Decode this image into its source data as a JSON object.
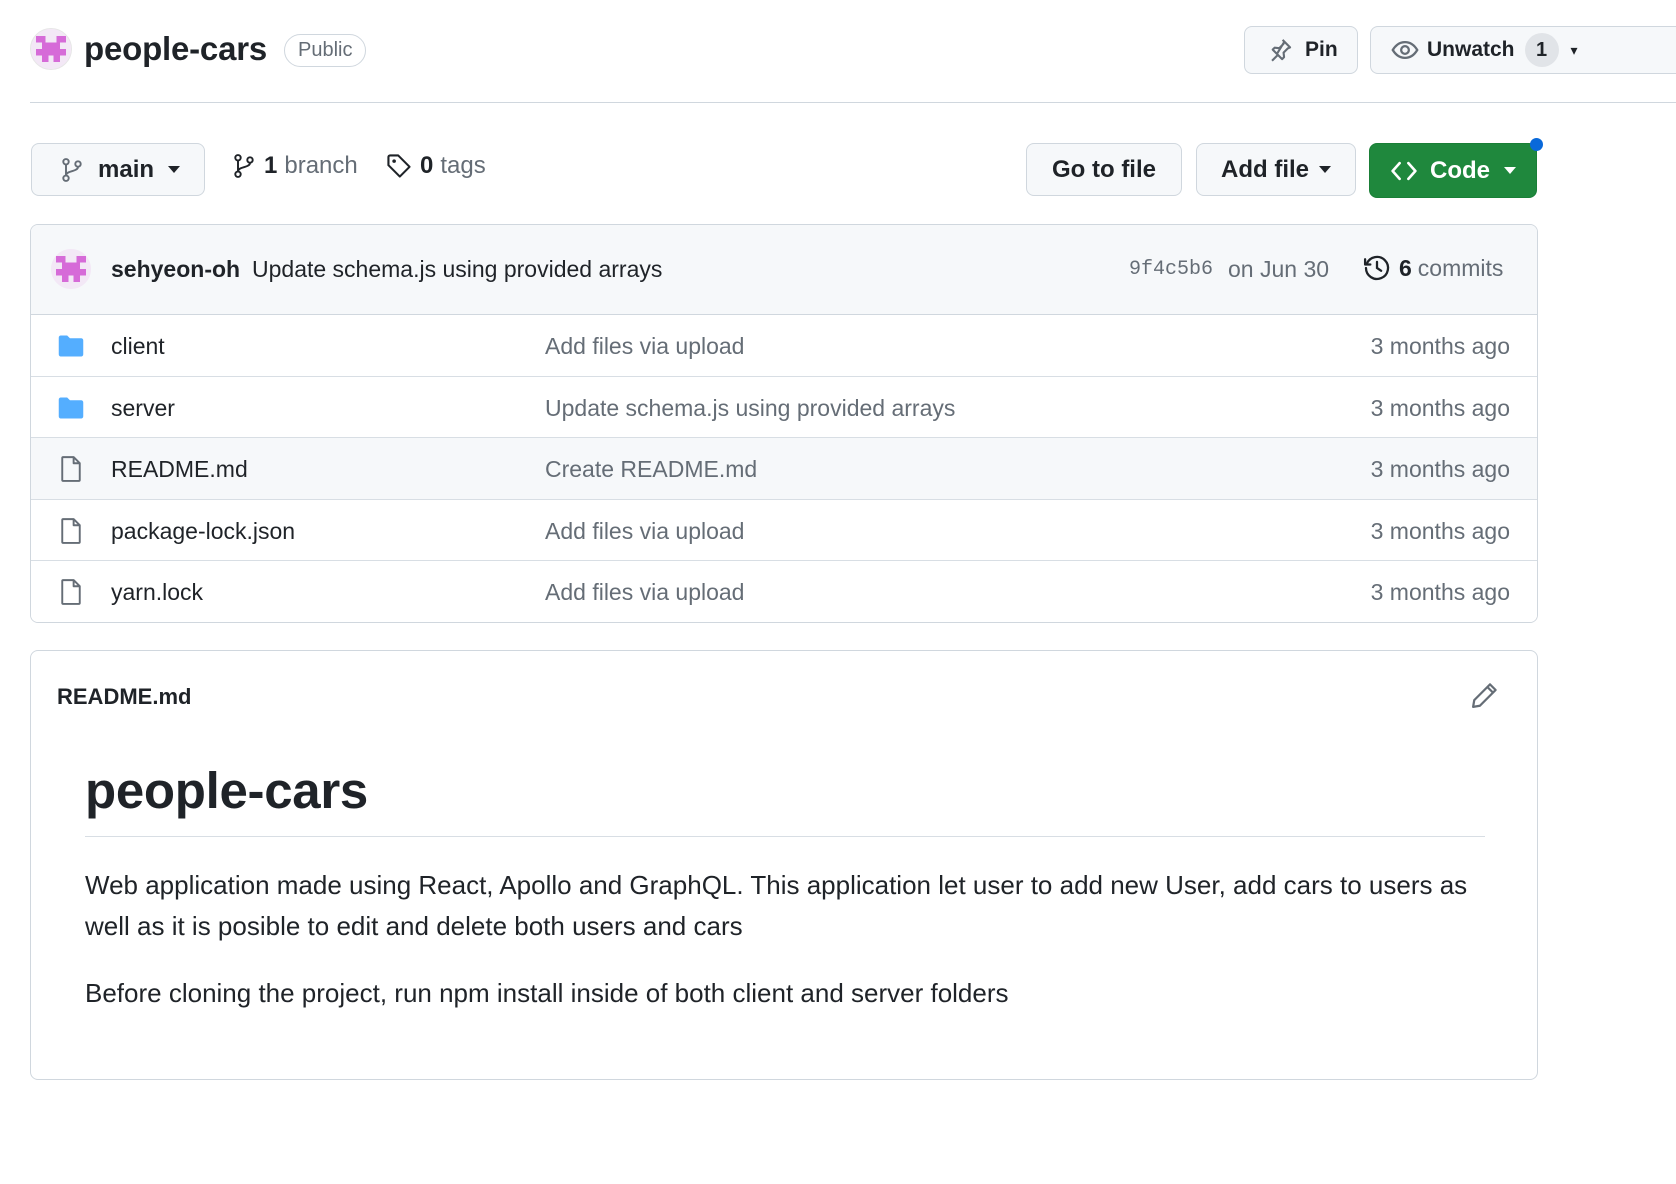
{
  "repo": {
    "name": "people-cars",
    "visibility": "Public",
    "pin_label": "Pin",
    "watch_label": "Unwatch",
    "watch_count": "1"
  },
  "branch_bar": {
    "current_branch": "main",
    "branch_count": "1",
    "branch_word": "branch",
    "tag_count": "0",
    "tag_word": "tags",
    "go_to_file": "Go to file",
    "add_file": "Add file",
    "code": "Code"
  },
  "latest_commit": {
    "author": "sehyeon-oh",
    "message": "Update schema.js using provided arrays",
    "sha": "9f4c5b6",
    "date": "on Jun 30",
    "commit_count": "6",
    "commit_word": "commits"
  },
  "files": [
    {
      "name": "client",
      "type": "folder",
      "message": "Add files via upload",
      "age": "3 months ago"
    },
    {
      "name": "server",
      "type": "folder",
      "message": "Update schema.js using provided arrays",
      "age": "3 months ago"
    },
    {
      "name": "README.md",
      "type": "file",
      "message": "Create README.md",
      "age": "3 months ago"
    },
    {
      "name": "package-lock.json",
      "type": "file",
      "message": "Add files via upload",
      "age": "3 months ago"
    },
    {
      "name": "yarn.lock",
      "type": "file",
      "message": "Add files via upload",
      "age": "3 months ago"
    }
  ],
  "readme": {
    "file_title": "README.md",
    "heading": "people-cars",
    "paragraph_1": "Web application made using React, Apollo and GraphQL. This application let user to add new User, add cars to users as well as it is posible to edit and delete both users and cars",
    "paragraph_2": "Before cloning the project, run npm install inside of both client and server folders"
  },
  "colors": {
    "code_button": "#1f883d",
    "folder_icon": "#54aeff",
    "avatar_accent": "#d66bd8",
    "notification_dot": "#0969da"
  },
  "icons": [
    "pin-icon",
    "eye-icon",
    "git-branch-icon",
    "tag-icon",
    "code-icon",
    "history-icon",
    "folder-icon",
    "file-icon",
    "pencil-icon"
  ]
}
